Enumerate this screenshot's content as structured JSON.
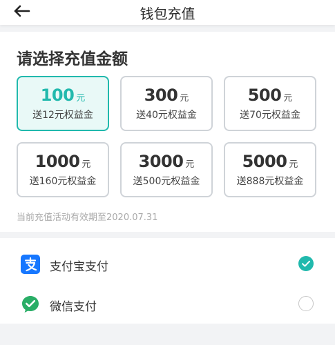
{
  "header": {
    "title": "钱包充值"
  },
  "main": {
    "section_title": "请选择充值金额",
    "options": [
      {
        "amount": "100",
        "unit": "元",
        "bonus": "送12元权益金",
        "selected": true
      },
      {
        "amount": "300",
        "unit": "元",
        "bonus": "送40元权益金",
        "selected": false
      },
      {
        "amount": "500",
        "unit": "元",
        "bonus": "送70元权益金",
        "selected": false
      },
      {
        "amount": "1000",
        "unit": "元",
        "bonus": "送160元权益金",
        "selected": false
      },
      {
        "amount": "3000",
        "unit": "元",
        "bonus": "送500元权益金",
        "selected": false
      },
      {
        "amount": "5000",
        "unit": "元",
        "bonus": "送888元权益金",
        "selected": false
      }
    ],
    "notice": "当前充值活动有效期至2020.07.31"
  },
  "payment": {
    "methods": [
      {
        "label": "支付宝支付",
        "icon": "alipay-icon",
        "selected": true
      },
      {
        "label": "微信支付",
        "icon": "wechat-pay-icon",
        "selected": false
      }
    ]
  },
  "colors": {
    "accent": "#21b9ad",
    "alipay": "#1677ff",
    "wechat": "#2aae67"
  }
}
